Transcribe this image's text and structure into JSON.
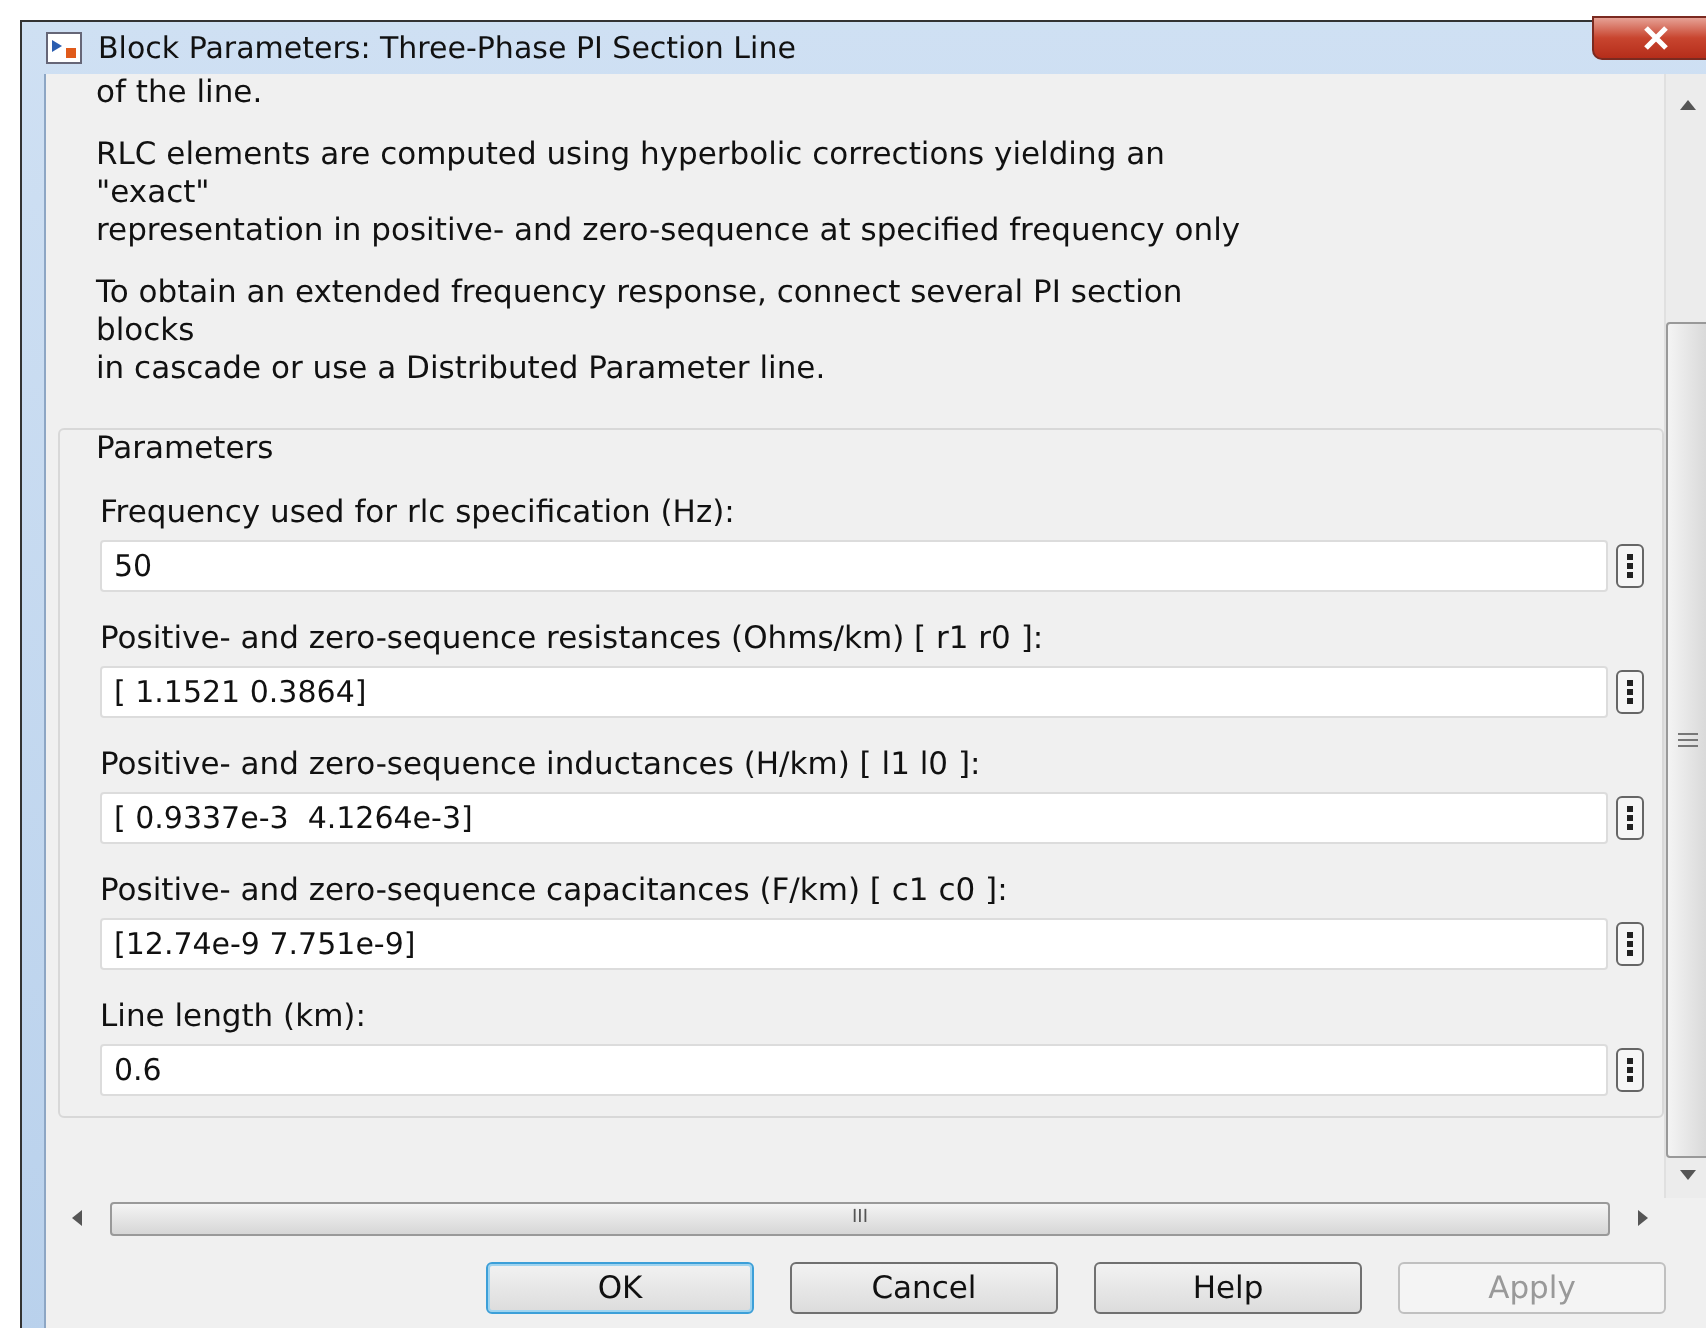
{
  "window": {
    "title": "Block Parameters: Three-Phase PI Section Line"
  },
  "description": [
    [
      "of the line."
    ],
    [
      "RLC elements are computed using hyperbolic corrections yielding an",
      "\"exact\"",
      "representation in positive- and zero-sequence at specified frequency only"
    ],
    [
      "To obtain an extended frequency response, connect several PI section",
      "blocks",
      "in cascade or use a Distributed Parameter line."
    ]
  ],
  "parameters": {
    "title": "Parameters",
    "fields": [
      {
        "label": "Frequency used for rlc specification (Hz):",
        "value": "50"
      },
      {
        "label": "Positive- and zero-sequence resistances (Ohms/km) [ r1  r0 ]:",
        "value": "[ 1.1521 0.3864]"
      },
      {
        "label": "Positive- and zero-sequence inductances (H/km) [ l1  l0 ]:",
        "value": "[ 0.9337e-3  4.1264e-3]"
      },
      {
        "label": "Positive- and zero-sequence capacitances (F/km) [ c1 c0 ]:",
        "value": "[12.74e-9 7.751e-9]"
      },
      {
        "label": "Line length (km):",
        "value": "0.6"
      }
    ]
  },
  "horizontal_scrollbar": {
    "grip": "III"
  },
  "buttons": [
    {
      "label": "OK",
      "default": true,
      "disabled": false
    },
    {
      "label": "Cancel",
      "default": false,
      "disabled": false
    },
    {
      "label": "Help",
      "default": false,
      "disabled": false
    },
    {
      "label": "Apply",
      "default": false,
      "disabled": true
    }
  ]
}
